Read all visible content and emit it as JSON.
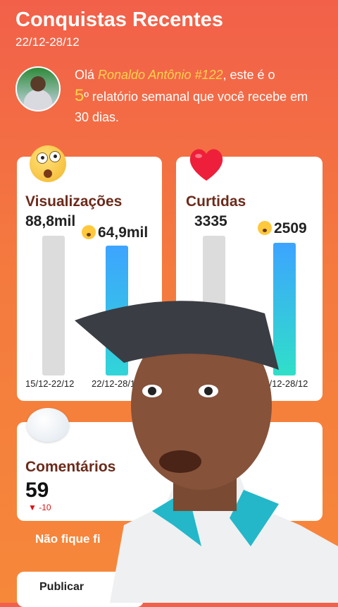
{
  "header": {
    "title": "Conquistas Recentes",
    "date_range": "22/12-28/12"
  },
  "intro": {
    "prefix": "Olá ",
    "name": "Ronaldo Antônio #122",
    "middle": ", este é o ",
    "number": "5",
    "suffix": "º relatório semanal que você recebe em 30 dias."
  },
  "views": {
    "title": "Visualizações",
    "prev_value": "88,8mil",
    "curr_value": "64,9mil",
    "prev_range": "15/12-22/12",
    "curr_range": "22/12-28/12",
    "prev": 88.8,
    "curr": 64.9
  },
  "likes": {
    "title": "Curtidas",
    "prev_value": "3335",
    "curr_value": "2509",
    "curr_range": "22/12-28/12",
    "prev": 3335,
    "curr": 2509
  },
  "comments": {
    "title": "Comentários",
    "count": "59",
    "delta": "-10"
  },
  "footer": {
    "tip": "Não fique fi",
    "publish": "Publicar"
  },
  "colors": {
    "background": "#f47a3e",
    "accent": "#ffd34d",
    "title_text": "#6b2a1a",
    "bar_gray": "#dcdcdc",
    "bar_blue": "#3da4ff",
    "decline": "#dd1111"
  },
  "icons": [
    "surprised-emoji-icon",
    "heart-icon",
    "speech-bubble-icon",
    "dizzy-emoji-icon",
    "down-triangle-icon"
  ]
}
